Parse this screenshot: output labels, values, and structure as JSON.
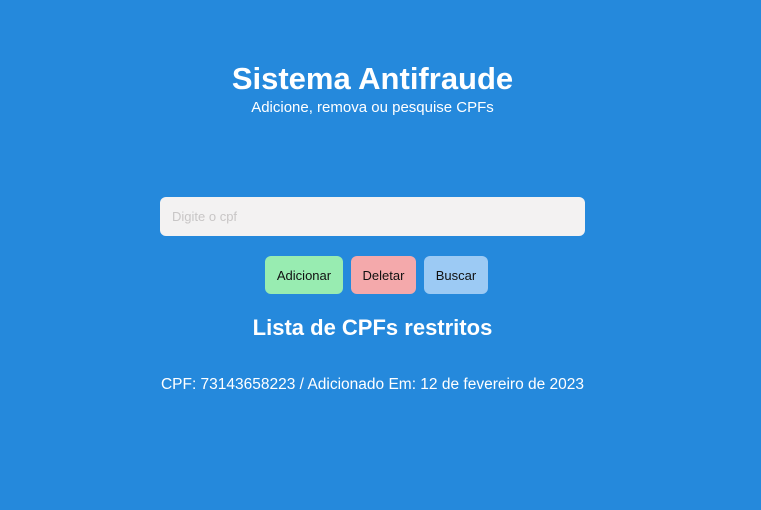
{
  "header": {
    "title": "Sistema Antifraude",
    "subtitle": "Adicione, remova ou pesquise CPFs"
  },
  "form": {
    "cpf_placeholder": "Digite o cpf",
    "cpf_value": ""
  },
  "actions": {
    "add_label": "Adicionar",
    "delete_label": "Deletar",
    "search_label": "Buscar"
  },
  "list": {
    "title": "Lista de CPFs restritos",
    "items": [
      {
        "text": "CPF: 73143658223 / Adicionado Em: 12 de fevereiro de 2023"
      }
    ]
  },
  "colors": {
    "background": "#2589dc",
    "add_button": "#98ecb1",
    "delete_button": "#f4a9ab",
    "search_button": "#9ccaf4",
    "input_background": "#f3f2f2"
  }
}
